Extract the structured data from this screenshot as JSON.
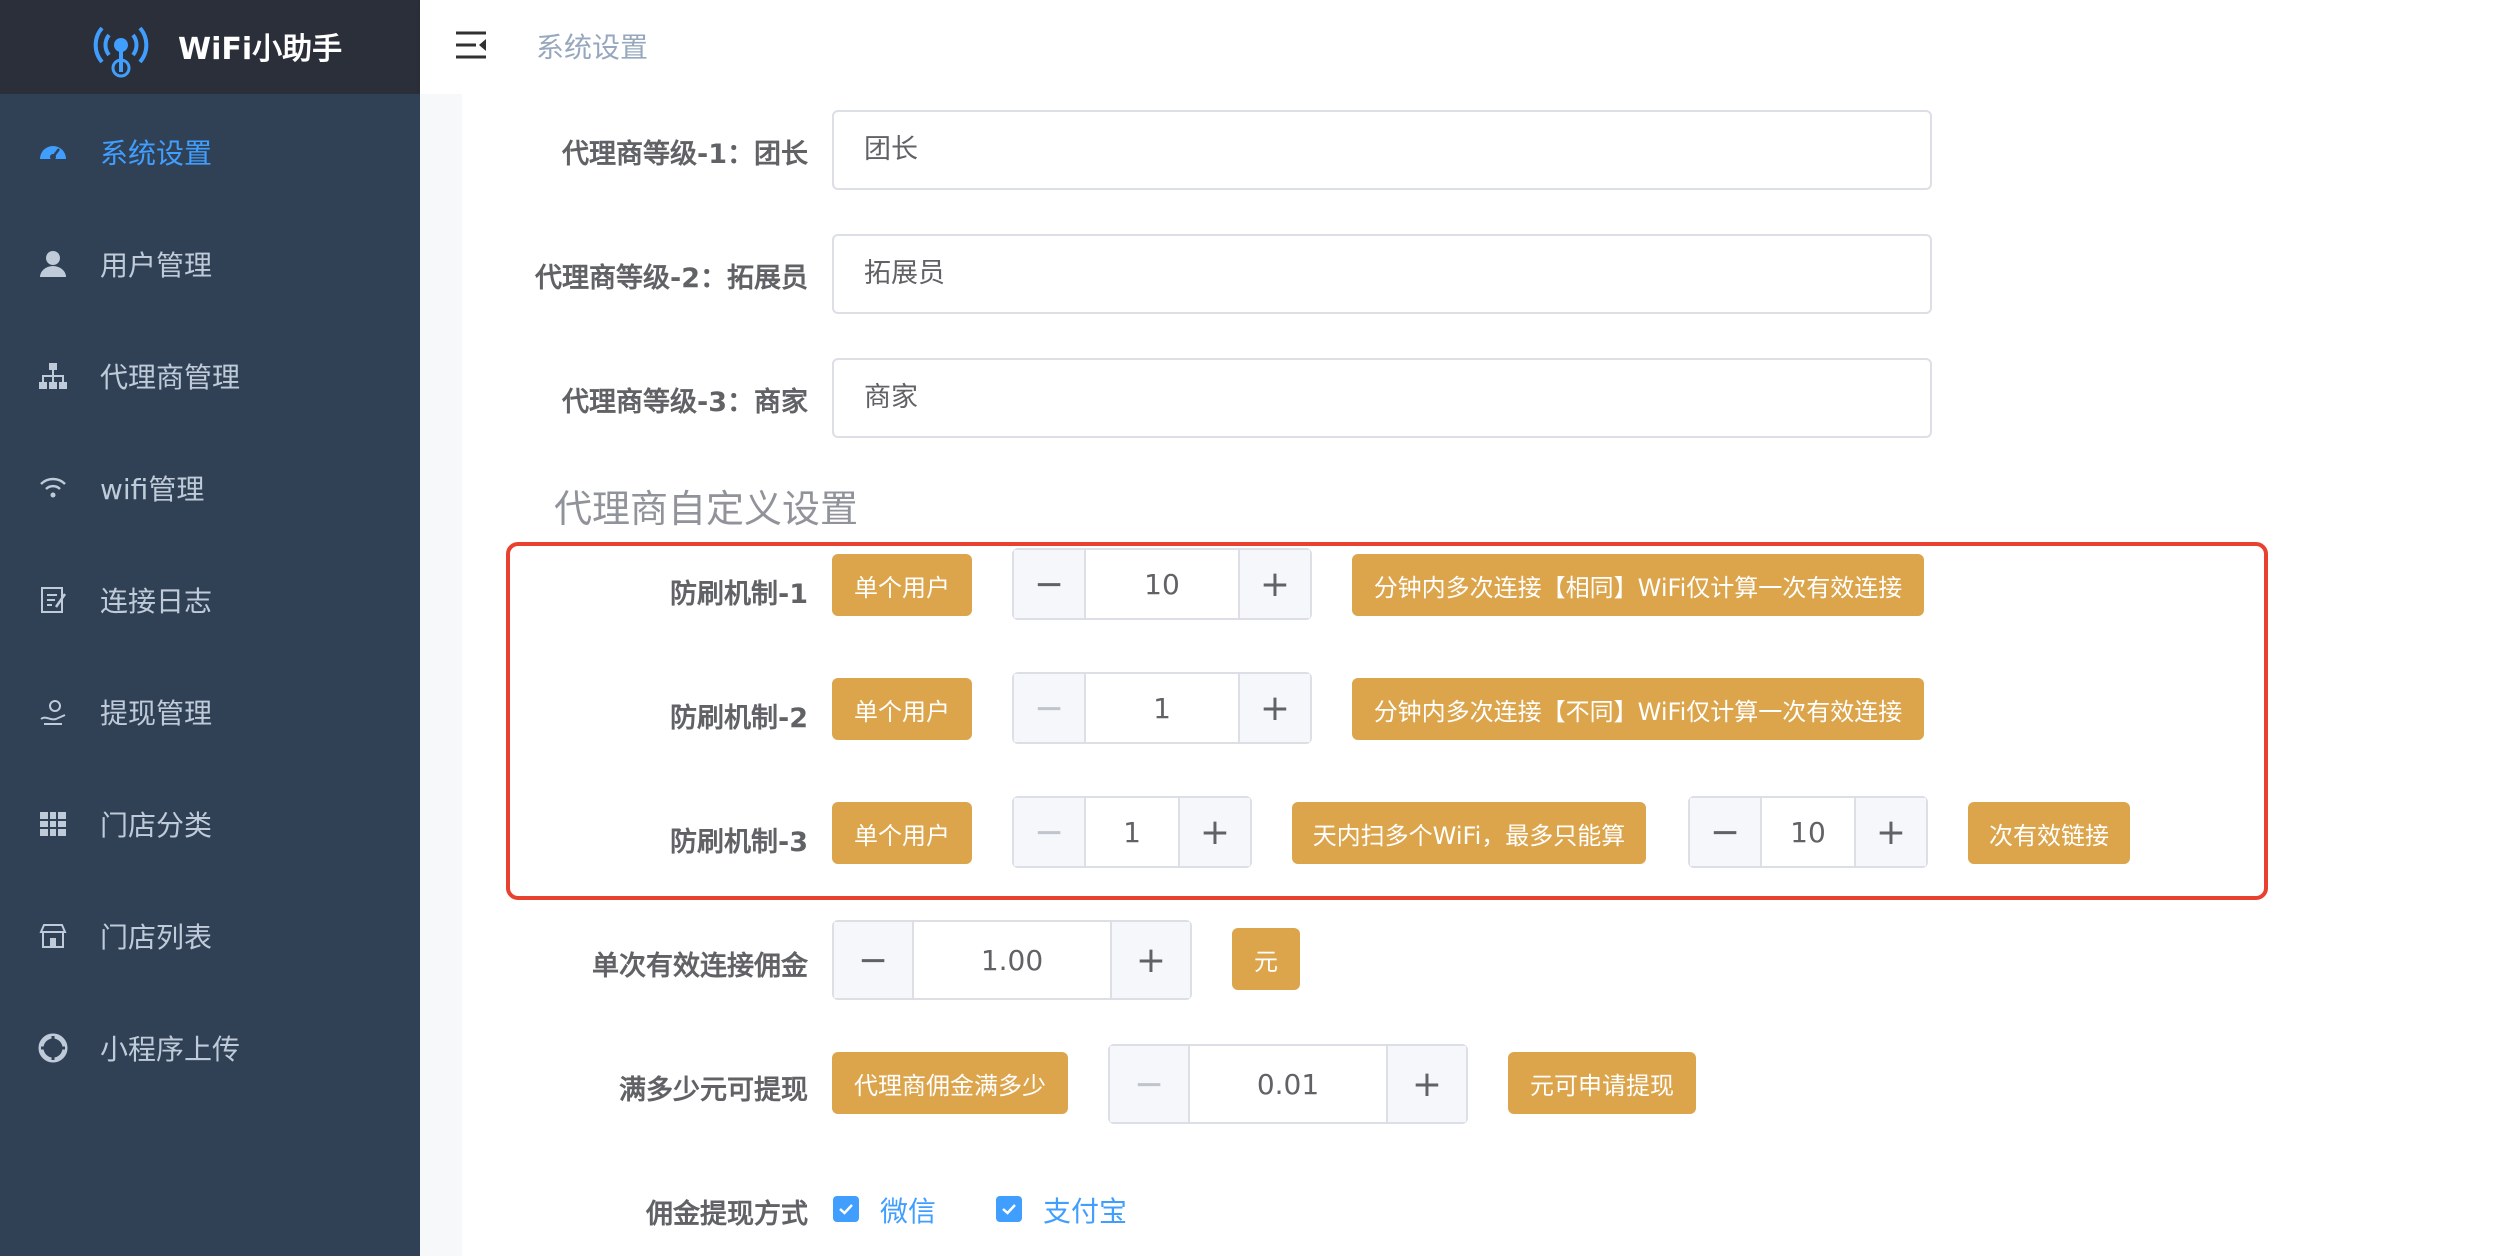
{
  "app": {
    "title": "WiFi小助手"
  },
  "sidebar": {
    "items": [
      {
        "label": "系统设置",
        "icon": "dashboard-icon"
      },
      {
        "label": "用户管理",
        "icon": "user-icon"
      },
      {
        "label": "代理商管理",
        "icon": "tree-icon"
      },
      {
        "label": "wifi管理",
        "icon": "wifi-icon"
      },
      {
        "label": "连接日志",
        "icon": "log-icon"
      },
      {
        "label": "提现管理",
        "icon": "withdraw-icon"
      },
      {
        "label": "门店分类",
        "icon": "grid-icon"
      },
      {
        "label": "门店列表",
        "icon": "shop-icon"
      },
      {
        "label": "小程序上传",
        "icon": "upload-icon"
      }
    ]
  },
  "header": {
    "breadcrumb": "系统设置"
  },
  "agent_levels": [
    {
      "label": "代理商等级-1：团长",
      "value": "团长"
    },
    {
      "label": "代理商等级-2：拓展员",
      "value": "拓展员"
    },
    {
      "label": "代理商等级-3：商家",
      "value": "商家"
    }
  ],
  "custom_section_title": "代理商自定义设置",
  "anti_fraud": [
    {
      "label": "防刷机制-1",
      "scope": "单个用户",
      "value": "10",
      "desc": "分钟内多次连接【相同】WiFi仅计算一次有效连接"
    },
    {
      "label": "防刷机制-2",
      "scope": "单个用户",
      "value": "1",
      "desc": "分钟内多次连接【不同】WiFi仅计算一次有效连接"
    },
    {
      "label": "防刷机制-3",
      "scope": "单个用户",
      "value": "1",
      "desc": "天内扫多个WiFi，最多只能算",
      "value2": "10",
      "desc2": "次有效链接"
    }
  ],
  "commission": {
    "label": "单次有效连接佣金",
    "value": "1.00",
    "unit": "元"
  },
  "withdraw_min": {
    "label": "满多少元可提现",
    "prefix": "代理商佣金满多少",
    "value": "0.01",
    "suffix": "元可申请提现"
  },
  "withdraw_methods": {
    "label": "佣金提现方式",
    "options": [
      {
        "label": "微信",
        "checked": true
      },
      {
        "label": "支付宝",
        "checked": true
      }
    ]
  },
  "colors": {
    "sidebar_bg": "#304156",
    "active": "#409eff",
    "tag": "#dca54c",
    "highlight_border": "#e8412f"
  }
}
